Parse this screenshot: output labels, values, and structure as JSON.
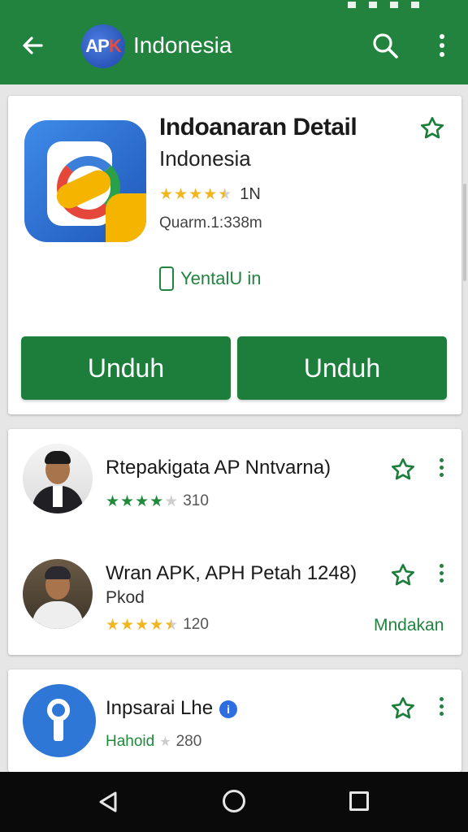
{
  "appbar": {
    "logo_text_1": "AP",
    "logo_text_2": "K",
    "title": "Indonesia"
  },
  "detail": {
    "title": "Indoanaran Detail",
    "subtitle": "Indonesia",
    "rating_count": "1N",
    "rating": 4.5,
    "version": "Quarm.1:338m",
    "install_label": "YentalU in",
    "button_1": "Unduh",
    "button_2": "Unduh"
  },
  "list": [
    {
      "title": "Rtepakigata AP Nntvarna)",
      "rating": 4,
      "rating_count": "310"
    },
    {
      "title": "Wran APK, APH Petah 1248)",
      "sub": "Pkod",
      "rating": 4.5,
      "rating_count": "120",
      "action": "Mndakan"
    },
    {
      "title": "Inpsarai Lhe",
      "verified_mark": "i",
      "developer": "Hahoid",
      "rating_count": "280"
    }
  ],
  "colors": {
    "appbar": "#21833e",
    "accent_green": "#1d7e3c",
    "star_gold": "#f2b61d",
    "star_green": "#1e8a3a"
  }
}
